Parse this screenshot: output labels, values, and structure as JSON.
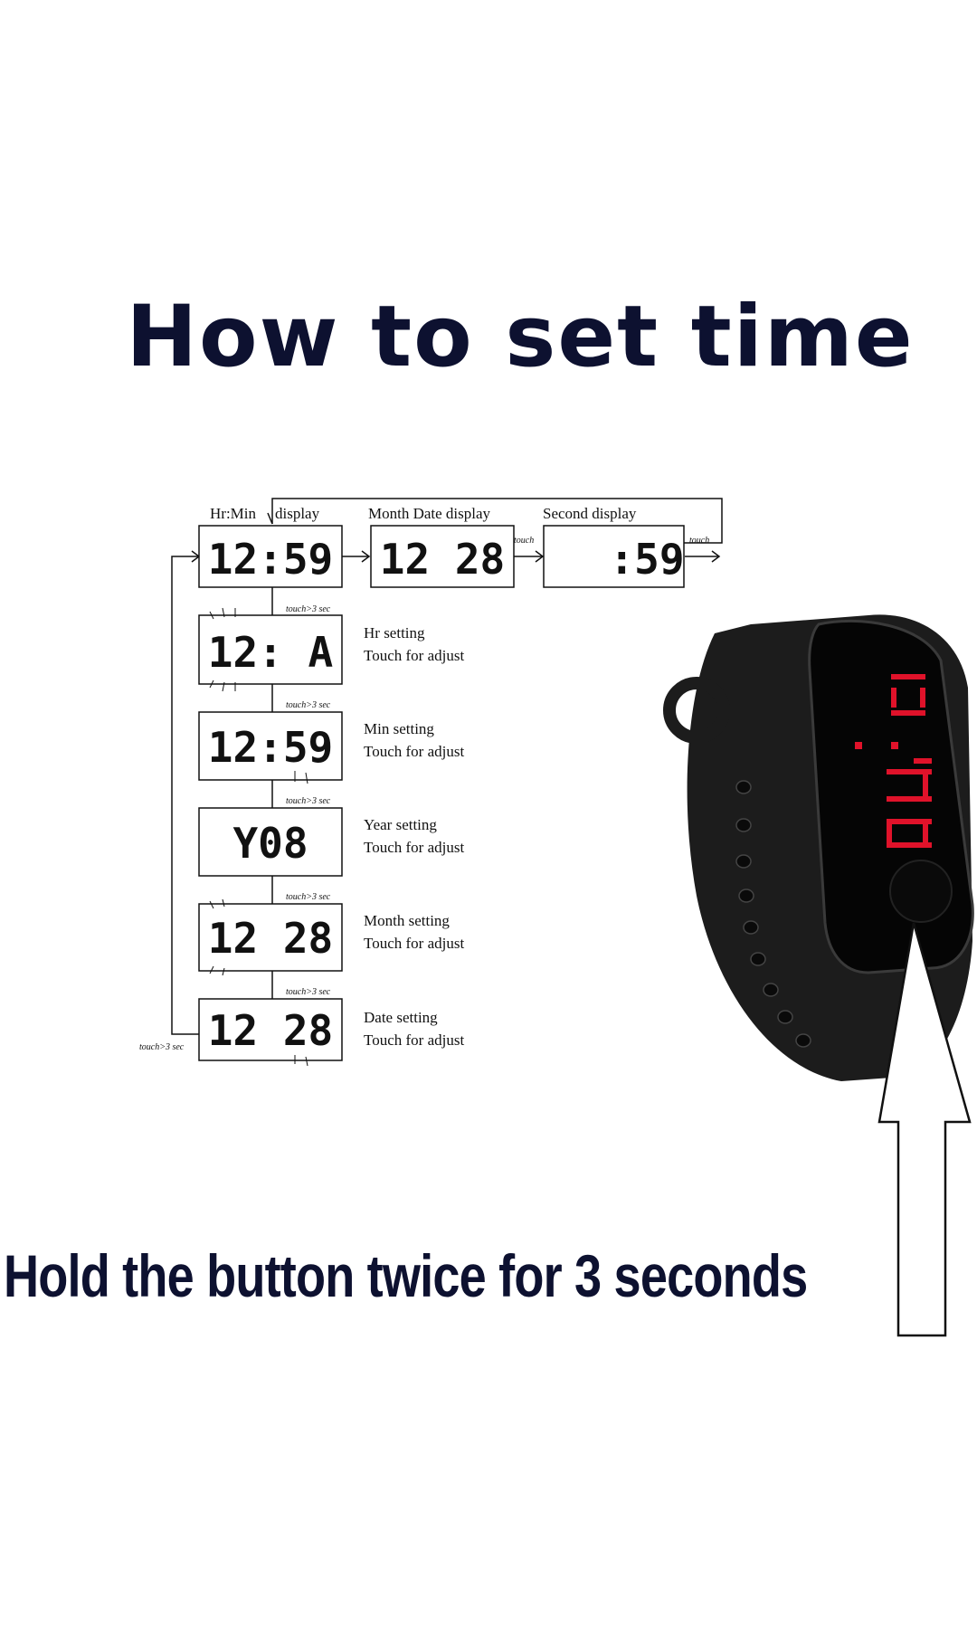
{
  "title": "How to set time",
  "footer": "Hold the button twice for 3 seconds",
  "top_row": [
    {
      "header": "Hr:Min",
      "header2": "display",
      "digits": "12:59"
    },
    {
      "header": "Month Date display",
      "digits": "12 28"
    },
    {
      "header": "Second display",
      "digits": ":59"
    }
  ],
  "touch_label": "touch",
  "hold_label": "touch>3 sec",
  "steps": [
    {
      "digits": "12: A",
      "line1": "Hr setting",
      "line2": "Touch for adjust"
    },
    {
      "digits": "12:59",
      "line1": "Min setting",
      "line2": "Touch for adjust"
    },
    {
      "digits": "Y08",
      "line1": "Year setting",
      "line2": "Touch for adjust"
    },
    {
      "digits": "12 28",
      "line1": "Month setting",
      "line2": "Touch for adjust"
    },
    {
      "digits": "12 28",
      "line1": "Date setting",
      "line2": "Touch for adjust"
    }
  ],
  "colors": {
    "title": "#0d1130",
    "band": "#1c1c1c",
    "led": "#e0122a"
  }
}
